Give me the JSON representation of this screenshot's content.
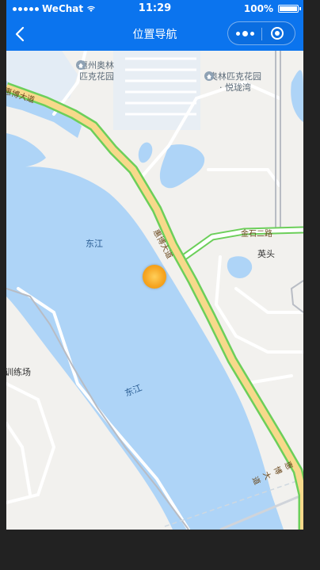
{
  "status_bar": {
    "carrier": "WeChat",
    "time": "11:29",
    "battery": "100%"
  },
  "navbar": {
    "title": "位置导航"
  },
  "map": {
    "pois": [
      {
        "name_line1": "惠州奥林",
        "name_line2": "匹克花园"
      },
      {
        "name_line1": "奥林匹克花园",
        "name_line2": "· 悦珑湾"
      }
    ],
    "labels": {
      "river_1": "东江",
      "river_2": "东江",
      "road_huibo_1": "惠博大道",
      "road_huibo_2": "惠博大道",
      "road_huibo_3": "惠博大道",
      "road_jinshi": "金石二路",
      "town_yingtou": "英头",
      "training_ground": "训练场"
    },
    "colors": {
      "water": "#aed4f7",
      "land": "#f2f1ee",
      "highway_fill": "#f7d98b",
      "highway_border": "#6ccf5a",
      "marker": "#f6a623"
    }
  }
}
